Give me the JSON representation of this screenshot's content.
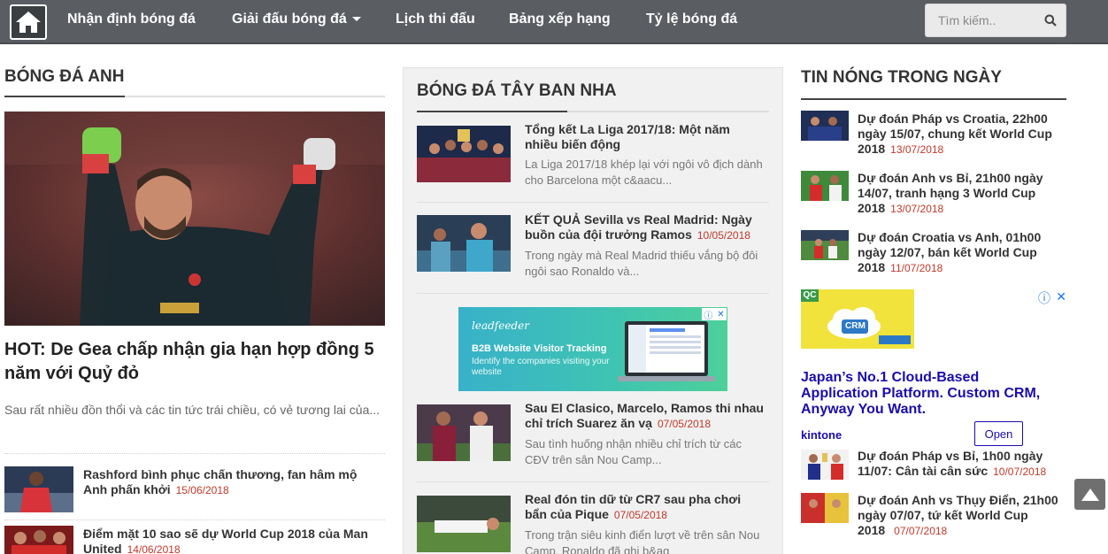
{
  "nav": {
    "items": [
      "Nhận định bóng đá",
      "Giải đấu bóng đá",
      "Lịch thi đấu",
      "Bảng xếp hạng",
      "Tỷ lệ bóng đá"
    ],
    "search_placeholder": "Tìm kiếm.."
  },
  "left": {
    "title": "BÓNG ĐÁ ANH",
    "hero_title": "HOT: De Gea chấp nhận gia hạn hợp đồng 5 năm với Quỷ đỏ",
    "hero_desc": "Sau rất nhiều đồn thổi và các tin tức trái chiều, có vẻ tương lai của...",
    "items": [
      {
        "title": "Rashford bình phục chấn thương, fan hâm mộ Anh phấn khởi",
        "date": "15/06/2018"
      },
      {
        "title": "Điểm mặt 10 sao sẽ dự World Cup 2018 của Man United",
        "date": "14/06/2018"
      }
    ]
  },
  "middle": {
    "title": "BÓNG ĐÁ TÂY BAN NHA",
    "items": [
      {
        "title": "Tổng kết La Liga 2017/18: Một năm nhiều biến động",
        "date": "",
        "desc": "La Liga 2017/18 khép lại với ngôi vô địch dành cho Barcelona một c&aacu..."
      },
      {
        "title": "KẾT QUẢ Sevilla vs Real Madrid: Ngày buồn của đội trưởng Ramos",
        "date": "10/05/2018",
        "desc": "Trong ngày mà Real Madrid thiếu vắng bộ đôi ngôi sao Ronaldo và..."
      },
      {
        "title": "Sau El Clasico, Marcelo, Ramos thi nhau chỉ trích Suarez ăn vạ",
        "date": "07/05/2018",
        "desc": "Sau tình huống nhận nhiều chỉ trích từ các CĐV trên sân Nou Camp..."
      },
      {
        "title": "Real đón tin dữ từ CR7 sau pha chơi bẩn của Pique",
        "date": "07/05/2018",
        "desc": "Trong trận siêu kinh điển lượt về trên sân Nou Camp, Ronaldo đã ghi b&ag"
      }
    ],
    "ad": {
      "logo": "leadfeeder",
      "headline": "B2B Website Visitor Tracking",
      "text": "Identify the companies visiting your website"
    }
  },
  "right": {
    "title": "TIN NÓNG TRONG NGÀY",
    "items": [
      {
        "title": "Dự đoán Pháp vs Croatia, 22h00 ngày 15/07, chung kết World Cup 2018",
        "date": "13/07/2018"
      },
      {
        "title": "Dự đoán Anh vs Bỉ, 21h00 ngày 14/07, tranh hạng 3 World Cup 2018",
        "date": "13/07/2018"
      },
      {
        "title": "Dự đoán Croatia vs Anh, 01h00 ngày 12/07, bán kết World Cup 2018",
        "date": "11/07/2018"
      },
      {
        "title": "Dự đoán Pháp vs Bỉ, 1h00 ngày 11/07: Cân tài cân sức",
        "date": "10/07/2018"
      },
      {
        "title": "Dự đoán Anh vs Thụy Điển, 21h00 ngày 07/07, tứ kết World Cup 2018",
        "date": "07/07/2018"
      }
    ],
    "ad": {
      "badge": "QC",
      "crm_label": "CRM",
      "title": "Japan’s No.1 Cloud-Based Application Platform. Custom CRM, Anyway You Want.",
      "brand": "kintone",
      "cta": "Open"
    }
  },
  "colors": {
    "nav_bg": "#5a5e62",
    "date_red": "#c0392b",
    "ad_link": "#1a0dab"
  }
}
